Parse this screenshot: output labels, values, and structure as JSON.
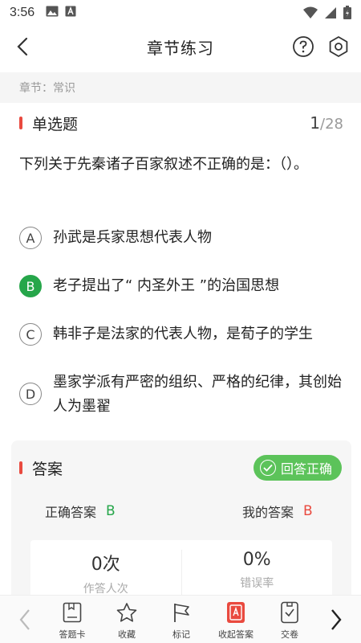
{
  "status_bar": {
    "time": "3:56"
  },
  "header": {
    "title": "章节练习"
  },
  "chapter": {
    "label": "章节：常识"
  },
  "question_type": {
    "label": "单选题",
    "current": "1",
    "total": "/28"
  },
  "question": {
    "text": "下列关于先秦诸子百家叙述不正确的是：（）。"
  },
  "options": [
    {
      "letter": "A",
      "text": "孙武是兵家思想代表人物"
    },
    {
      "letter": "B",
      "text": "老子提出了“ 内圣外王 ”的治国思想"
    },
    {
      "letter": "C",
      "text": "韩非子是法家的代表人物，是荀子的学生"
    },
    {
      "letter": "D",
      "text": "墨家学派有严密的组织、严格的纪律，其创始人为墨翟"
    }
  ],
  "selected_option": "B",
  "answer": {
    "title": "答案",
    "badge": "回答正确",
    "correct_label": "正确答案",
    "correct_value": "B",
    "mine_label": "我的答案",
    "mine_value": "B",
    "stats": [
      {
        "value": "0次",
        "caption": "作答人次"
      },
      {
        "value": "0%",
        "caption": "错误率"
      }
    ]
  },
  "toolbar": {
    "items": [
      {
        "label": "答题卡",
        "icon": "answer-card-icon"
      },
      {
        "label": "收藏",
        "icon": "star-icon"
      },
      {
        "label": "标记",
        "icon": "flag-icon"
      },
      {
        "label": "收起答案",
        "icon": "hide-answer-icon"
      },
      {
        "label": "交卷",
        "icon": "submit-paper-icon"
      }
    ]
  },
  "colors": {
    "accent_red": "#e94a3f",
    "correct_green": "#26a64a",
    "badge_green": "#5cc35a"
  }
}
